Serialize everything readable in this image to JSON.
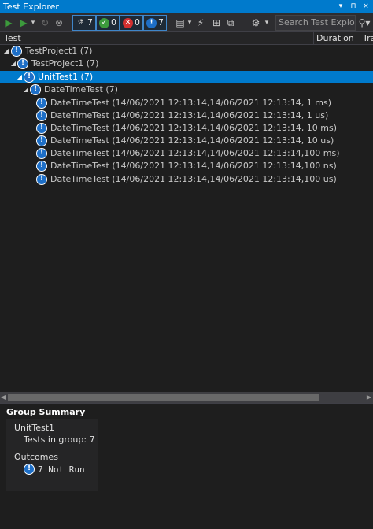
{
  "window": {
    "title": "Test Explorer",
    "controls": [
      "▾",
      "⊓",
      "×"
    ]
  },
  "toolbar": {
    "run_all": "▶",
    "run": "▶",
    "run_dropdown": "▾",
    "repeat": "↻",
    "cancel": "⊗",
    "filters": [
      {
        "name": "total",
        "count": "7",
        "icon": "⚗",
        "color": "#6e6e6e"
      },
      {
        "name": "passed",
        "count": "0",
        "icon": "✓",
        "color": "#3c9a3c"
      },
      {
        "name": "failed",
        "count": "0",
        "icon": "✕",
        "color": "#d32f2f"
      },
      {
        "name": "not-run",
        "count": "7",
        "icon": "!",
        "color": "#1e6fc7"
      }
    ],
    "playlist": "▤",
    "playlist_dropdown": "▾",
    "live": "⚡",
    "group": "⊞",
    "collapse": "⧉",
    "settings": "⚙",
    "settings_dropdown": "▾",
    "search_placeholder": "Search Test Explorer (C",
    "search_button": "⚲▾"
  },
  "columns": {
    "test": "Test",
    "duration": "Duration",
    "traits": "Tra"
  },
  "tree": [
    {
      "label": "TestProject1 (7)",
      "level": 0
    },
    {
      "label": "TestProject1 (7)",
      "level": 1
    },
    {
      "label": "UnitTest1 (7)",
      "level": 2,
      "selected": true
    },
    {
      "label": "DateTimeTest (7)",
      "level": 3
    },
    {
      "label": "DateTimeTest (14/06/2021 12:13:14,14/06/2021 12:13:14,  1 ms)",
      "level": 4
    },
    {
      "label": "DateTimeTest (14/06/2021 12:13:14,14/06/2021 12:13:14,  1 us)",
      "level": 4
    },
    {
      "label": "DateTimeTest (14/06/2021 12:13:14,14/06/2021 12:13:14, 10 ms)",
      "level": 4
    },
    {
      "label": "DateTimeTest (14/06/2021 12:13:14,14/06/2021 12:13:14, 10 us)",
      "level": 4
    },
    {
      "label": "DateTimeTest (14/06/2021 12:13:14,14/06/2021 12:13:14,100 ms)",
      "level": 4
    },
    {
      "label": "DateTimeTest (14/06/2021 12:13:14,14/06/2021 12:13:14,100 ns)",
      "level": 4
    },
    {
      "label": "DateTimeTest (14/06/2021 12:13:14,14/06/2021 12:13:14,100 us)",
      "level": 4
    }
  ],
  "summary": {
    "title": "Group Summary",
    "group": "UnitTest1",
    "tests_in_group": "Tests in group:  7",
    "outcomes": "Outcomes",
    "not_run": "7 Not Run"
  },
  "colors": {
    "accent": "#007acc",
    "background": "#1e1e1e",
    "not_run_icon": "#1e6fc7"
  }
}
